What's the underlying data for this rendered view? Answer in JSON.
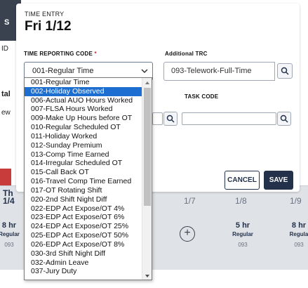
{
  "background": {
    "cut_texts": [
      "S",
      "ID",
      "tal",
      "ew",
      "Th",
      "1/4"
    ],
    "days": [
      "1/7",
      "1/8",
      "1/9"
    ],
    "cells": [
      {
        "hours": "8 hr",
        "label": "Regular",
        "code": "093"
      },
      {
        "hours": "5 hr",
        "label": "Regular",
        "code": "093"
      },
      {
        "hours": "8 hr",
        "label": "Regula",
        "code": "093"
      }
    ]
  },
  "modal": {
    "subtitle": "TIME ENTRY",
    "title": "Fri 1/12",
    "trc_label": "TIME REPORTING CODE",
    "required_mark": "*",
    "trc_value": "001-Regular Time",
    "additional_trc_label": "Additional TRC",
    "additional_trc_value": "093-Telework-Full-Time",
    "task_code_label": "TASK CODE",
    "cancel_label": "CANCEL",
    "save_label": "SAVE"
  },
  "dropdown": {
    "selected_index": 1,
    "scroll_position": 0.0,
    "items": [
      "001-Regular Time",
      "002-Holiday Observed",
      "006-Actual AUO Hours Worked",
      "007-FLSA Hours Worked",
      "009-Make Up Hours before OT",
      "010-Regular Scheduled OT",
      "011-Holiday Worked",
      "012-Sunday Premium",
      "013-Comp Time Earned",
      "014-Irregular Scheduled OT",
      "015-Call Back OT",
      "016-Travel Comp Time Earned",
      "017-OT Rotating Shift",
      "020-2nd Shift Night Diff",
      "022-EDP Act Expose/OT 4%",
      "023-EDP Act Expose/OT 6%",
      "024-EDP Act Expose/OT 25%",
      "025-EDP Act Expose/OT 50%",
      "026-EDP Act Expose/OT 8%",
      "030-3rd Shift Night Diff",
      "032-Admin Leave",
      "037-Jury Duty"
    ]
  },
  "colors": {
    "primary": "#23324a",
    "selection": "#1c6fd1",
    "required": "#c53030"
  }
}
